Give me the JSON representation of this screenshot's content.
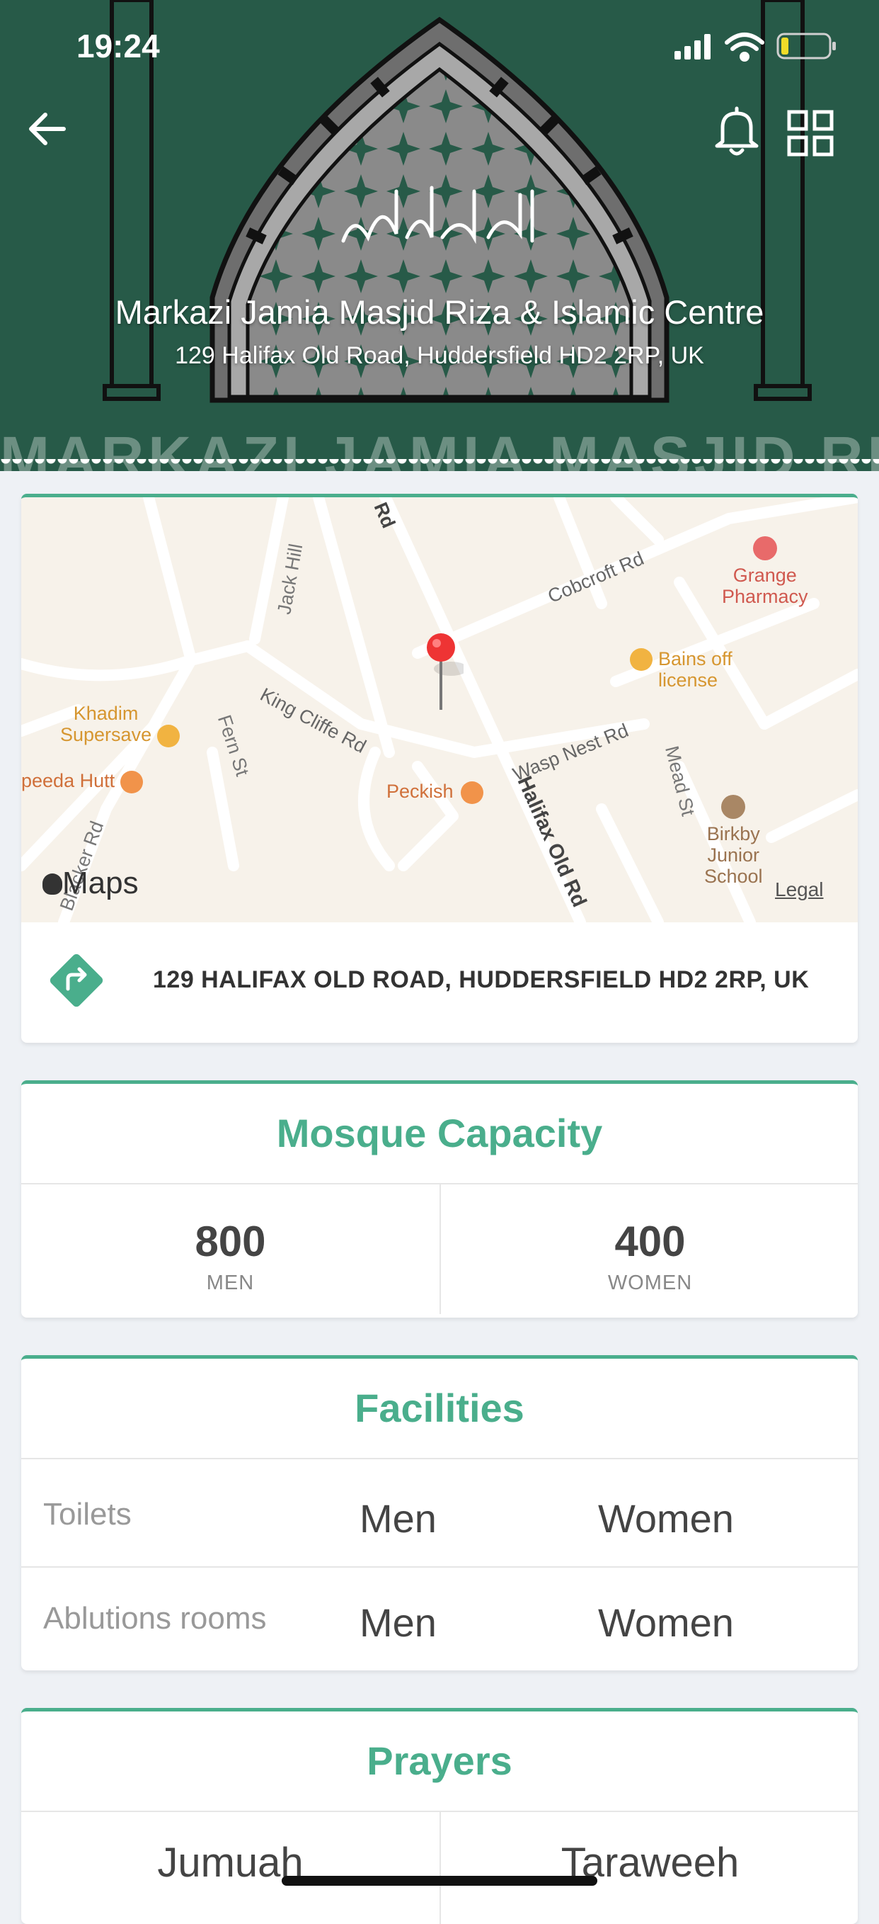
{
  "status_bar": {
    "time": "19:24"
  },
  "header": {
    "title": "Markazi Jamia Masjid Riza & Islamic Centre",
    "address": "129 Halifax Old Road, Huddersfield HD2 2RP, UK",
    "watermark": "MARKAZI JAMIA MASJID RIZA",
    "calligraphy": "لا اله الا الله محمد رسول الله",
    "colors": {
      "background": "#275a48",
      "accent": "#4aae8c"
    },
    "icons": [
      "back-arrow-icon",
      "bell-icon",
      "grid-icon"
    ]
  },
  "map": {
    "labels": {
      "grange_pharmacy": "Grange\nPharmacy",
      "cobcroft_rd": "Cobcroft Rd",
      "rd": "Rd",
      "jack_hill": "Jack Hill",
      "bains_off_license": "Bains off\nlicense",
      "khadim_supersave": "Khadim\nSupersave",
      "king_cliffe_rd": "King Cliffe Rd",
      "fern_st": "Fern St",
      "wasp_nest_rd": "Wasp Nest Rd",
      "mead_st": "Mead St",
      "peeda_hutt": "peeda Hutt",
      "peckish": "Peckish",
      "halifax_old_rd": "Halifax Old Rd",
      "birkby_junior_school": "Birkby\nJunior\nSchool",
      "blacker_rd": "Blacker Rd"
    },
    "brand": "Maps",
    "legal": "Legal"
  },
  "address_row": {
    "text": "129 HALIFAX OLD ROAD, HUDDERSFIELD HD2 2RP, UK"
  },
  "capacity": {
    "title": "Mosque Capacity",
    "men_value": "800",
    "men_label": "MEN",
    "women_value": "400",
    "women_label": "WOMEN"
  },
  "facilities": {
    "title": "Facilities",
    "rows": [
      {
        "name": "Toilets",
        "men": "Men",
        "women": "Women"
      },
      {
        "name": "Ablutions rooms",
        "men": "Men",
        "women": "Women"
      }
    ]
  },
  "prayers": {
    "title": "Prayers",
    "items": [
      "Jumuah",
      "Taraweeh"
    ]
  }
}
